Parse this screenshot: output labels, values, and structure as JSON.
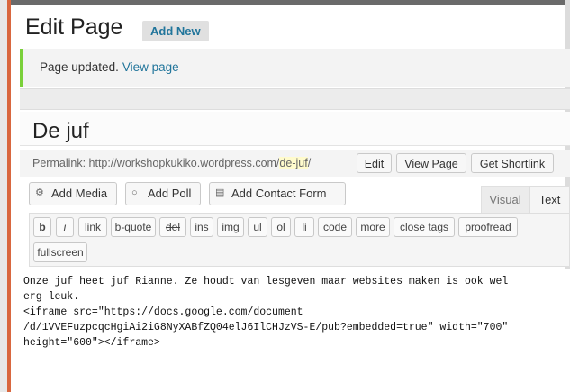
{
  "header": {
    "title": "Edit Page",
    "add_new": "Add New"
  },
  "notice": {
    "message": "Page updated.",
    "link": "View page"
  },
  "post": {
    "title": "De juf"
  },
  "permalink": {
    "label": "Permalink: http://workshopkukiko.wordpress.com/",
    "slug": "de-juf",
    "trailing": "/",
    "edit": "Edit",
    "view_page": "View Page",
    "get_shortlink": "Get Shortlink"
  },
  "media_buttons": {
    "add_media": "Add Media",
    "add_poll": "Add Poll",
    "add_contact_form": "Add Contact Form"
  },
  "editor_tabs": {
    "visual": "Visual",
    "text": "Text"
  },
  "quicktags": [
    "b",
    "i",
    "link",
    "b-quote",
    "del",
    "ins",
    "img",
    "ul",
    "ol",
    "li",
    "code",
    "more",
    "close tags",
    "proofread",
    "fullscreen"
  ],
  "editor": {
    "content": "Onze juf heet juf Rianne. Ze houdt van lesgeven maar websites maken is ook wel\nerg leuk.\n<iframe src=\"https://docs.google.com/document\n/d/1VVEFuzpcqcHgiAi2iG8NyXABfZQ04elJ6IlCHJzVS-E/pub?embedded=true\" width=\"700\"\nheight=\"600\"></iframe>"
  },
  "colors": {
    "accent": "#21759b",
    "notice_border": "#7ad03a",
    "slug_highlight": "#fffbcc"
  }
}
